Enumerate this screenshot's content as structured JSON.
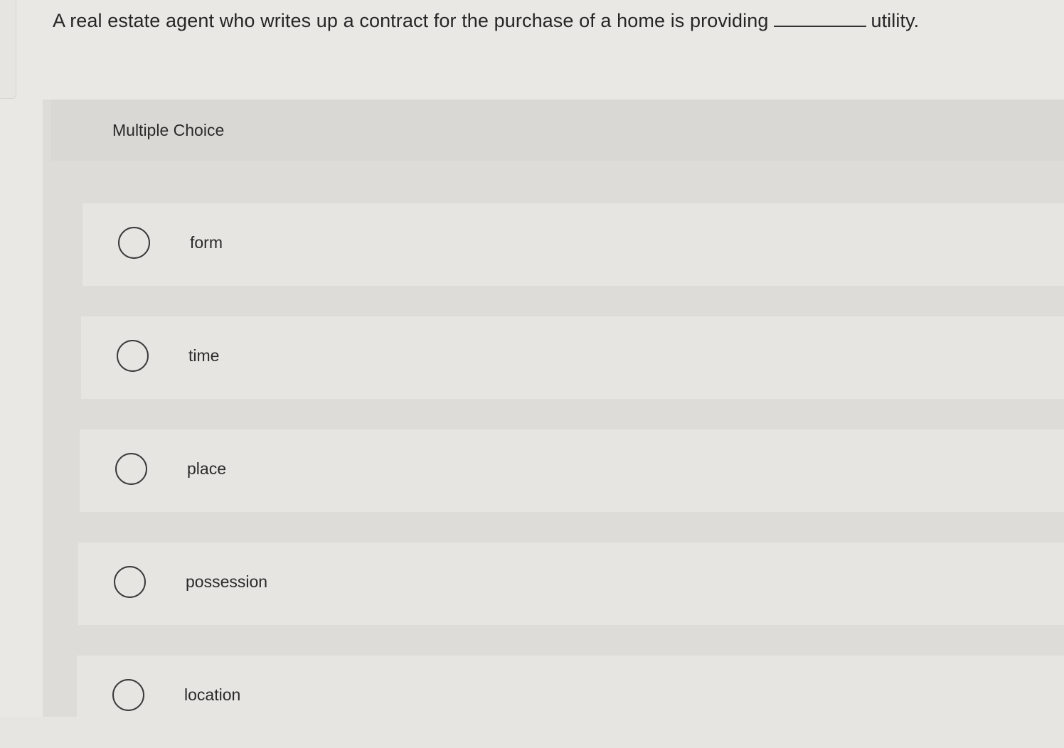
{
  "question": {
    "text_before": "A real estate agent who writes up a contract for the purchase of a home is providing",
    "text_after": "utility."
  },
  "panel": {
    "title": "Multiple Choice"
  },
  "options": [
    {
      "label": "form"
    },
    {
      "label": "time"
    },
    {
      "label": "place"
    },
    {
      "label": "possession"
    },
    {
      "label": "location"
    }
  ]
}
